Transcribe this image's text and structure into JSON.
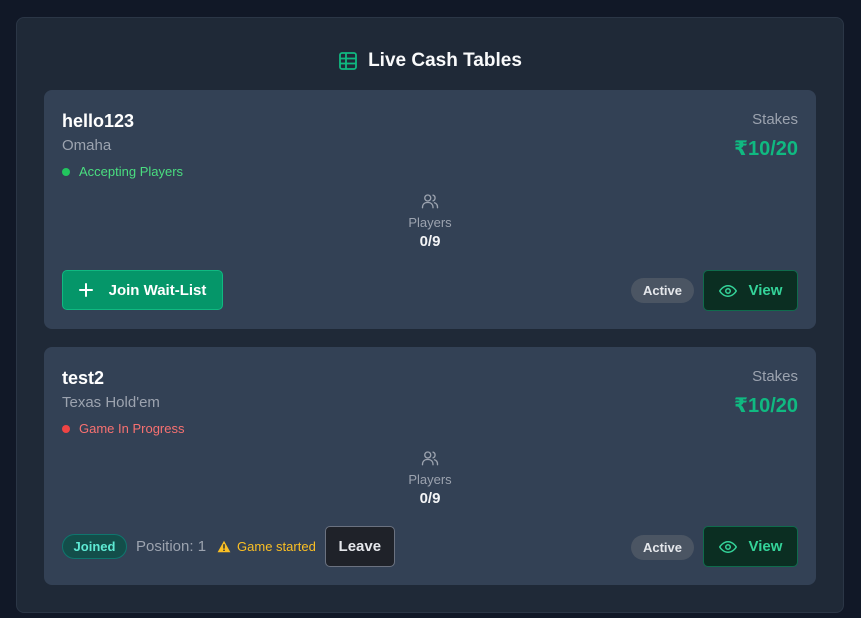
{
  "header": {
    "title": "Live Cash Tables",
    "icon": "table-icon"
  },
  "colors": {
    "accent": "#10b981",
    "accepting": "#22c55e",
    "in_progress": "#ef4444",
    "warning": "#fbbf24"
  },
  "tables": [
    {
      "name": "hello123",
      "game": "Omaha",
      "status": "Accepting Players",
      "stakes_label": "Stakes",
      "stakes_value": "₹10/20",
      "players_label": "Players",
      "players_count": "0/9",
      "join_label": "Join Wait-List",
      "active_label": "Active",
      "view_label": "View"
    },
    {
      "name": "test2",
      "game": "Texas Hold'em",
      "status": "Game In Progress",
      "stakes_label": "Stakes",
      "stakes_value": "₹10/20",
      "players_label": "Players",
      "players_count": "0/9",
      "joined_label": "Joined",
      "position_text": "Position: 1",
      "warning_text": "Game started",
      "leave_label": "Leave",
      "active_label": "Active",
      "view_label": "View"
    }
  ]
}
